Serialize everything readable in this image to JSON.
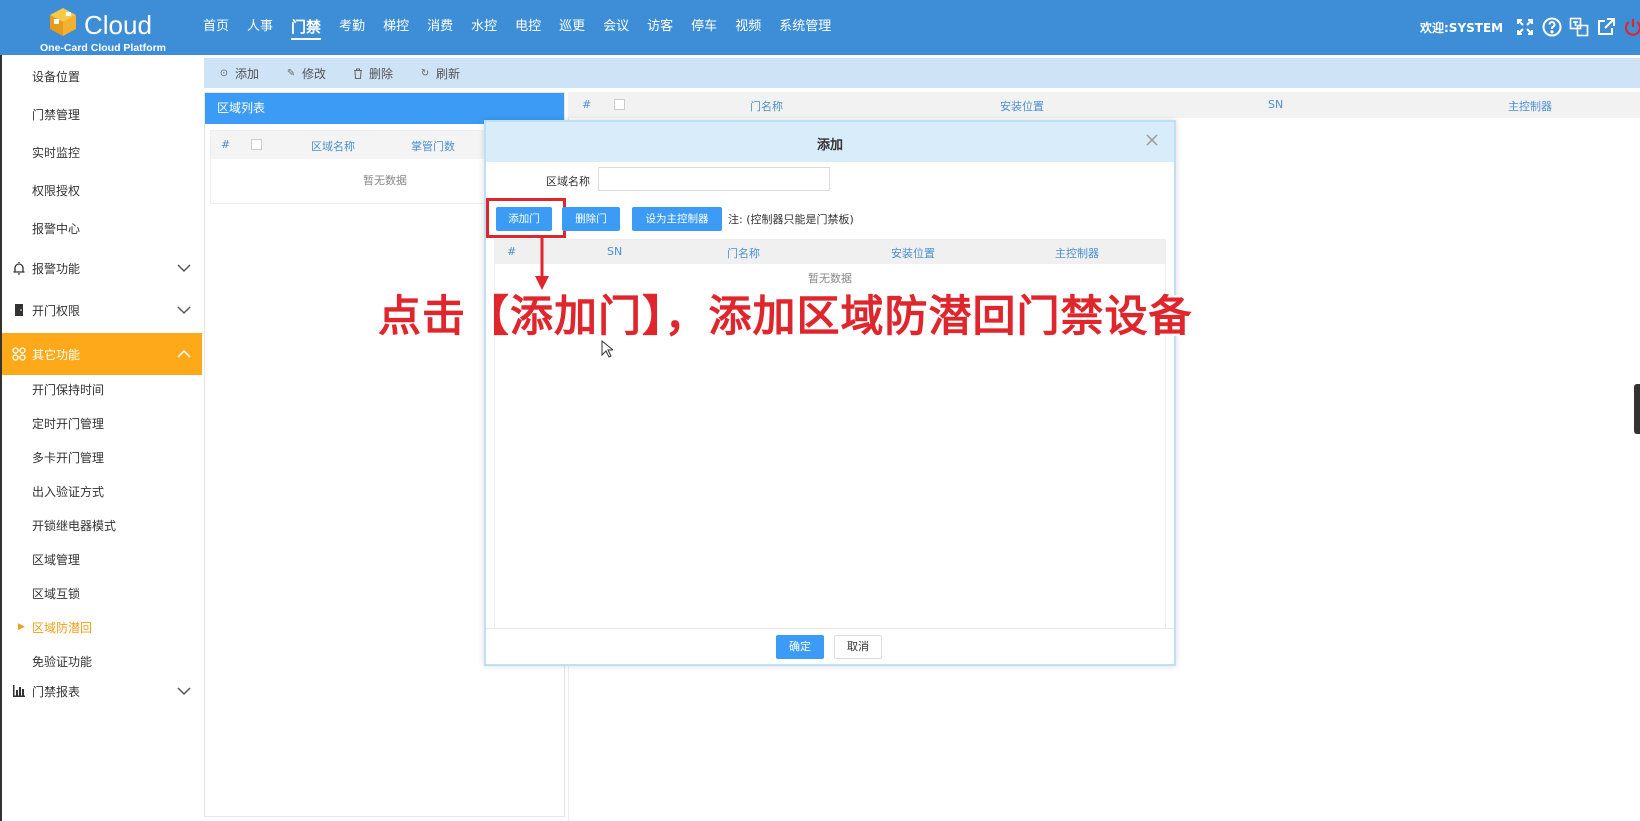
{
  "header": {
    "brand": "Cloud",
    "brand_sub": "One-Card Cloud Platform",
    "nav": [
      "首页",
      "人事",
      "门禁",
      "考勤",
      "梯控",
      "消费",
      "水控",
      "电控",
      "巡更",
      "会议",
      "访客",
      "停车",
      "视频",
      "系统管理"
    ],
    "active_nav": "门禁",
    "welcome": "欢迎:SYSTEM",
    "icons": [
      "fullscreen-icon",
      "help-icon",
      "translate-icon",
      "external-link-icon",
      "power-icon"
    ]
  },
  "sidebar": {
    "top_items": [
      "设备位置",
      "门禁管理",
      "实时监控",
      "权限授权",
      "报警中心"
    ],
    "groups": {
      "alarm": "报警功能",
      "door_auth": "开门权限",
      "other": "其它功能",
      "report": "门禁报表"
    },
    "other_items": [
      "开门保持时间",
      "定时开门管理",
      "多卡开门管理",
      "出入验证方式",
      "开锁继电器模式",
      "区域管理",
      "区域互锁",
      "区域防潜回",
      "免验证功能"
    ],
    "current_item": "区域防潜回"
  },
  "toolbar": {
    "add": "添加",
    "edit": "修改",
    "delete": "删除",
    "refresh": "刷新"
  },
  "area_panel": {
    "title": "区域列表",
    "columns": [
      "#",
      "区域名称",
      "掌管门数"
    ],
    "empty": "暂无数据"
  },
  "main_table": {
    "columns": [
      "#",
      "门名称",
      "安装位置",
      "SN",
      "主控制器"
    ]
  },
  "modal": {
    "title": "添加",
    "area_name_label": "区域名称",
    "area_name_value": "",
    "add_door": "添加门",
    "delete_door": "删除门",
    "set_master": "设为主控制器",
    "note": "注: (控制器只能是门禁板)",
    "columns": [
      "#",
      "SN",
      "门名称",
      "安装位置",
      "主控制器"
    ],
    "empty": "暂无数据",
    "ok": "确定",
    "cancel": "取消"
  },
  "annotation": {
    "text": "点击【添加门】，添加区域防潜回门禁设备",
    "color": "#e0262d"
  },
  "colors": {
    "header_bg": "#3d8ed6",
    "accent_blue": "#3c9cf5",
    "sidebar_active": "#fea91a"
  }
}
